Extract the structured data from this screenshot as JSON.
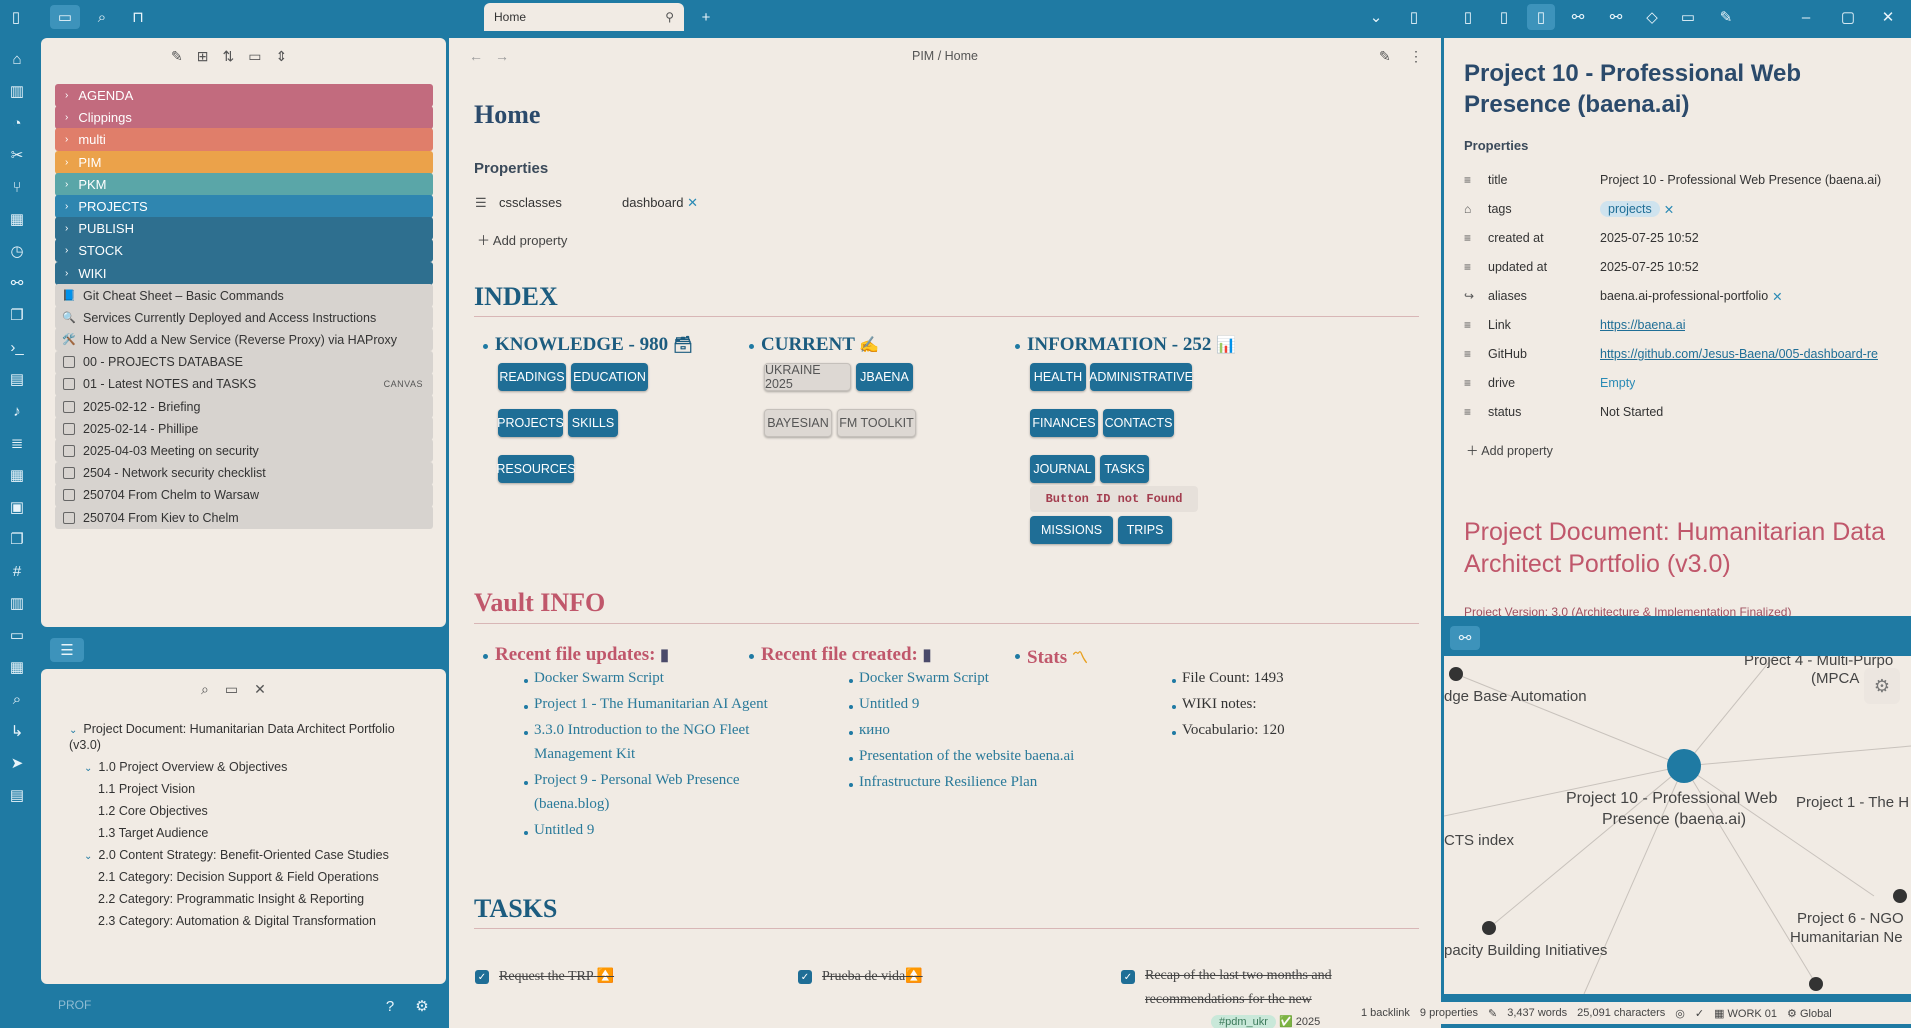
{
  "tabs": [
    {
      "label": "Home"
    }
  ],
  "file_explorer": {
    "folders": [
      {
        "label": "AGENDA",
        "color": "#c26b7e"
      },
      {
        "label": "Clippings",
        "color": "#c26b7e"
      },
      {
        "label": "multi",
        "color": "#e07e6a"
      },
      {
        "label": "PIM",
        "color": "#eba24a"
      },
      {
        "label": "PKM",
        "color": "#5aa6a8"
      },
      {
        "label": "PROJECTS",
        "color": "#2f86b0"
      },
      {
        "label": "PUBLISH",
        "color": "#2e6f8f"
      },
      {
        "label": "STOCK",
        "color": "#2e6f8f"
      },
      {
        "label": "WIKI",
        "color": "#2e6f8f"
      }
    ],
    "files": [
      {
        "label": "Git Cheat Sheet – Basic Commands",
        "icon": "📘"
      },
      {
        "label": "Services Currently Deployed and Access Instructions",
        "icon": "🔍"
      },
      {
        "label": "How to Add a New Service (Reverse Proxy) via HAProxy",
        "icon": "🛠️"
      },
      {
        "label": "00 - PROJECTS DATABASE",
        "icon": ""
      },
      {
        "label": "01 - Latest NOTES and TASKS",
        "icon": "",
        "badge": "CANVAS"
      },
      {
        "label": "2025-02-12 - Briefing",
        "icon": ""
      },
      {
        "label": "2025-02-14 - Phillipe",
        "icon": ""
      },
      {
        "label": "2025-04-03 Meeting on security",
        "icon": ""
      },
      {
        "label": "2504 - Network security checklist",
        "icon": ""
      },
      {
        "label": "250704 From Chelm to Warsaw",
        "icon": ""
      },
      {
        "label": "250704 From Kiev to Chelm",
        "icon": ""
      }
    ]
  },
  "outline": {
    "items": [
      {
        "label": "Project Document: Humanitarian Data Architect Portfolio",
        "level": 0
      },
      {
        "label": "(v3.0)",
        "level": 0
      },
      {
        "label": "1.0 Project Overview & Objectives",
        "level": 1
      },
      {
        "label": "1.1 Project Vision",
        "level": 2
      },
      {
        "label": "1.2 Core Objectives",
        "level": 2
      },
      {
        "label": "1.3 Target Audience",
        "level": 2
      },
      {
        "label": "2.0 Content Strategy: Benefit-Oriented Case Studies",
        "level": 1
      },
      {
        "label": "2.1 Category: Decision Support & Field Operations",
        "level": 2
      },
      {
        "label": "2.2 Category: Programmatic Insight & Reporting",
        "level": 2
      },
      {
        "label": "2.3 Category: Automation & Digital Transformation",
        "level": 2
      }
    ],
    "vault_name": "PROF"
  },
  "main": {
    "breadcrumb": "PIM / Home",
    "title": "Home",
    "properties_heading": "Properties",
    "prop_key": "cssclasses",
    "prop_val": "dashboard",
    "add_property": "Add property",
    "index_heading": "INDEX",
    "col1_title": "KNOWLEDGE - 980",
    "col2_title": "CURRENT",
    "col3_title": "INFORMATION - 252",
    "btns1": [
      "READINGS",
      "EDUCATION",
      "PROJECTS",
      "SKILLS",
      "RESOURCES"
    ],
    "btns2": [
      "UKRAINE 2025",
      "JBAENA",
      "BAYESIAN",
      "FM TOOLKIT"
    ],
    "btns3": [
      "HEALTH",
      "ADMINISTRATIVE",
      "FINANCES",
      "CONTACTS",
      "JOURNAL",
      "TASKS",
      "MISSIONS",
      "TRIPS"
    ],
    "btn_error": "Button ID not Found",
    "vault_heading": "Vault INFO",
    "recent_updates_title": "Recent file updates:",
    "recent_updates": [
      "Docker Swarm Script",
      "Project 1 - The Humanitarian AI Agent",
      "3.3.0 Introduction to the NGO Fleet",
      "Management Kit",
      "Project 9 - Personal Web Presence",
      "(baena.blog)",
      "Untitled 9"
    ],
    "recent_created_title": "Recent file created:",
    "recent_created": [
      "Docker Swarm Script",
      "Untitled 9",
      "кино",
      "Presentation of the website baena.ai",
      "Infrastructure Resilience Plan"
    ],
    "stats_title": "Stats",
    "stats": [
      "File Count: 1493",
      "WIKI notes:",
      "Vocabulario: 120"
    ],
    "tasks_heading": "TASKS",
    "tasks": [
      "Request the TRP",
      "Prueba de vida",
      "Recap of the last two months and",
      "recommendations for the new"
    ],
    "task_tag": "#pdm_ukr",
    "task_date": "2025"
  },
  "right": {
    "title_line1": "Project 10 - Professional Web",
    "title_line2": "Presence (baena.ai)",
    "properties_heading": "Properties",
    "props": [
      {
        "icon": "≡",
        "key": "title",
        "value": "Project 10 - Professional Web Presence (baena.ai)"
      },
      {
        "icon": "⌂",
        "key": "tags",
        "value": "projects"
      },
      {
        "icon": "≡",
        "key": "created at",
        "value": "2025-07-25 10:52"
      },
      {
        "icon": "≡",
        "key": "updated at",
        "value": "2025-07-25 10:52"
      },
      {
        "icon": "↪",
        "key": "aliases",
        "value": "baena.ai-professional-portfolio"
      },
      {
        "icon": "≡",
        "key": "Link",
        "value": "https://baena.ai"
      },
      {
        "icon": "≡",
        "key": "GitHub",
        "value": "https://github.com/Jesus-Baena/005-dashboard-re"
      },
      {
        "icon": "≡",
        "key": "drive",
        "value": "Empty"
      },
      {
        "icon": "≡",
        "key": "status",
        "value": "Not Started"
      }
    ],
    "add_property": "Add property",
    "doc_title_line1": "Project Document: Humanitarian Data",
    "doc_title_line2": "Architect Portfolio (v3.0)",
    "doc_sub": "Project Version: 3.0 (Architecture & Implementation Finalized)"
  },
  "graph": {
    "labels": [
      "Project 4 - Multi-Purpo",
      "(MPCA",
      "dge Base Automation",
      "Project 10 - Professional Web",
      "Presence (baena.ai)",
      "Project 1 - The H",
      "CTS index",
      "Project 6 - NGO",
      "Humanitarian Ne",
      "pacity Building Initiatives"
    ]
  },
  "status": {
    "backlinks": "1 backlink",
    "properties": "9 properties",
    "words": "3,437 words",
    "chars": "25,091 characters",
    "workspace": "WORK 01",
    "scope": "Global"
  }
}
